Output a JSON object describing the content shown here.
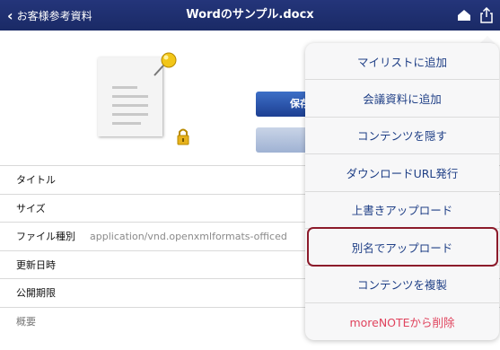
{
  "header": {
    "back_label": "お客様参考資料",
    "title": "Wordのサンプル.docx",
    "icons": [
      "home-icon",
      "share-icon"
    ]
  },
  "detail": {
    "save_button": "保存",
    "rows": [
      {
        "label": "タイトル",
        "value": ""
      },
      {
        "label": "サイズ",
        "value": ""
      },
      {
        "label": "ファイル種別",
        "value": "application/vnd.openxmlformats-officed"
      },
      {
        "label": "更新日時",
        "value": ""
      },
      {
        "label": "公開期限",
        "value": ""
      },
      {
        "label": "概要",
        "value": ""
      }
    ]
  },
  "menu": {
    "items": [
      {
        "label": "マイリストに追加"
      },
      {
        "label": "会議資料に追加"
      },
      {
        "label": "コンテンツを隠す"
      },
      {
        "label": "ダウンロードURL発行"
      },
      {
        "label": "上書きアップロード"
      },
      {
        "label": "別名でアップロード"
      },
      {
        "label": "コンテンツを複製"
      },
      {
        "label": "moreNOTEから削除"
      }
    ],
    "highlighted_index": 5,
    "text_color": "#1f3f86",
    "danger_color": "#e0435d"
  },
  "colors": {
    "header_bg": "#1a2a66",
    "highlight_border": "#8c1b2b"
  }
}
